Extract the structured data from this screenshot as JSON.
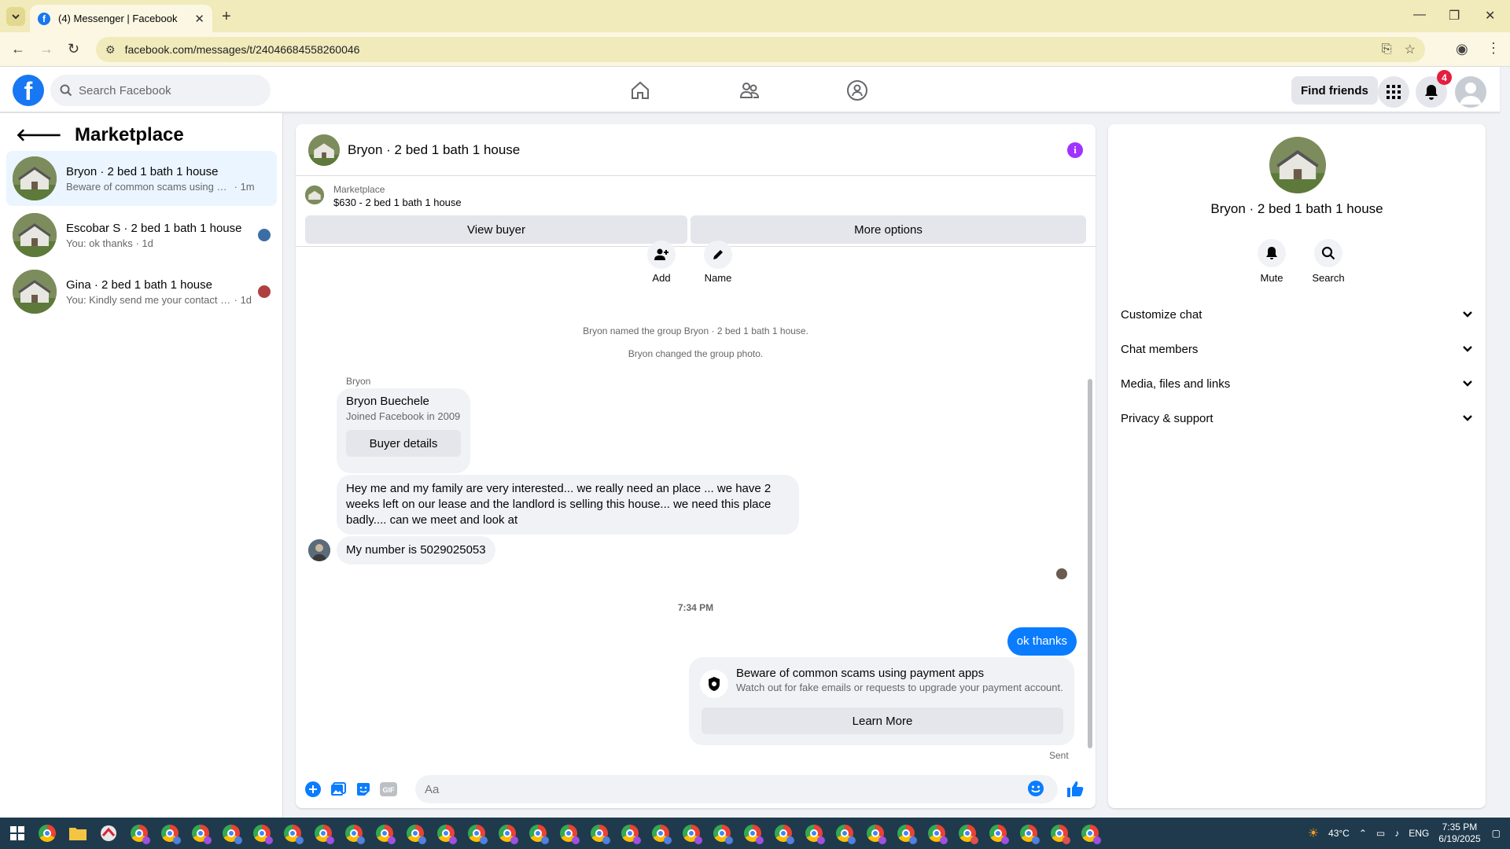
{
  "browser": {
    "tab_title": "(4) Messenger | Facebook",
    "url": "facebook.com/messages/t/24046684558260046"
  },
  "fb": {
    "search_placeholder": "Search Facebook",
    "find_friends": "Find friends",
    "notif_count": "4"
  },
  "sidebar": {
    "title": "Marketplace",
    "conversations": [
      {
        "name": "Bryon · 2 bed 1 bath 1 house",
        "preview": "Beware of common scams using pay...",
        "time": "· 1m",
        "active": true
      },
      {
        "name": "Escobar S · 2 bed 1 bath 1 house",
        "preview": "You: ok thanks",
        "time": "· 1d",
        "active": false
      },
      {
        "name": "Gina · 2 bed 1 bath 1 house",
        "preview": "You: Kindly send me your contact n...",
        "time": "· 1d",
        "active": false
      }
    ]
  },
  "chat": {
    "title": "Bryon · 2 bed 1 bath 1 house",
    "marketplace_label": "Marketplace",
    "listing": "$630 - 2 bed 1 bath 1 house",
    "view_buyer": "View buyer",
    "more_options": "More options",
    "tool_add": "Add",
    "tool_name": "Name",
    "sys_named": "Bryon named the group Bryon · 2 bed 1 bath 1 house.",
    "sys_photo": "Bryon changed the group photo.",
    "sender": "Bryon",
    "buyer_name": "Bryon Buechele",
    "buyer_joined": "Joined Facebook in 2009",
    "buyer_details": "Buyer details",
    "msg1": "Hey me and my family are very interested... we really need an place ... we have 2 weeks left on our lease and the landlord is selling this house... we need this place badly.... can we meet and look at",
    "msg2": "My number is 5029025053",
    "timestamp": "7:34 PM",
    "my_msg": "ok thanks",
    "scam_title": "Beware of common scams using payment apps",
    "scam_desc": "Watch out for fake emails or requests to upgrade your payment account.",
    "learn_more": "Learn More",
    "sent": "Sent",
    "input_placeholder": "Aa"
  },
  "details": {
    "title": "Bryon · 2 bed 1 bath 1 house",
    "mute": "Mute",
    "search": "Search",
    "sections": [
      "Customize chat",
      "Chat members",
      "Media, files and links",
      "Privacy & support"
    ]
  },
  "taskbar": {
    "temp": "43°C",
    "lang": "ENG",
    "time": "7:35 PM",
    "date": "6/19/2025"
  },
  "colors": {
    "fb_blue": "#1877f2",
    "my_bubble": "#0a7cff",
    "active_convo": "#ebf5ff"
  }
}
